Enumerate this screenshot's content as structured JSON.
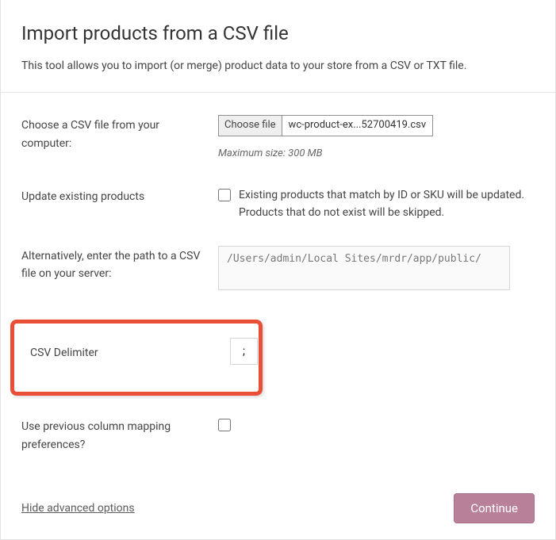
{
  "header": {
    "title": "Import products from a CSV file",
    "description": "This tool allows you to import (or merge) product data to your store from a CSV or TXT file."
  },
  "fields": {
    "choose_file": {
      "label": "Choose a CSV file from your computer:",
      "button": "Choose file",
      "filename": "wc-product-ex...52700419.csv",
      "hint": "Maximum size: 300 MB"
    },
    "update_existing": {
      "label": "Update existing products",
      "description": "Existing products that match by ID or SKU will be updated. Products that do not exist will be skipped."
    },
    "server_path": {
      "label": "Alternatively, enter the path to a CSV file on your server:",
      "value": "/Users/admin/Local Sites/mrdr/app/public/"
    },
    "delimiter": {
      "label": "CSV Delimiter",
      "value": ";"
    },
    "prev_mapping": {
      "label": "Use previous column mapping preferences?"
    }
  },
  "footer": {
    "hide_link": "Hide advanced options",
    "continue": "Continue"
  }
}
